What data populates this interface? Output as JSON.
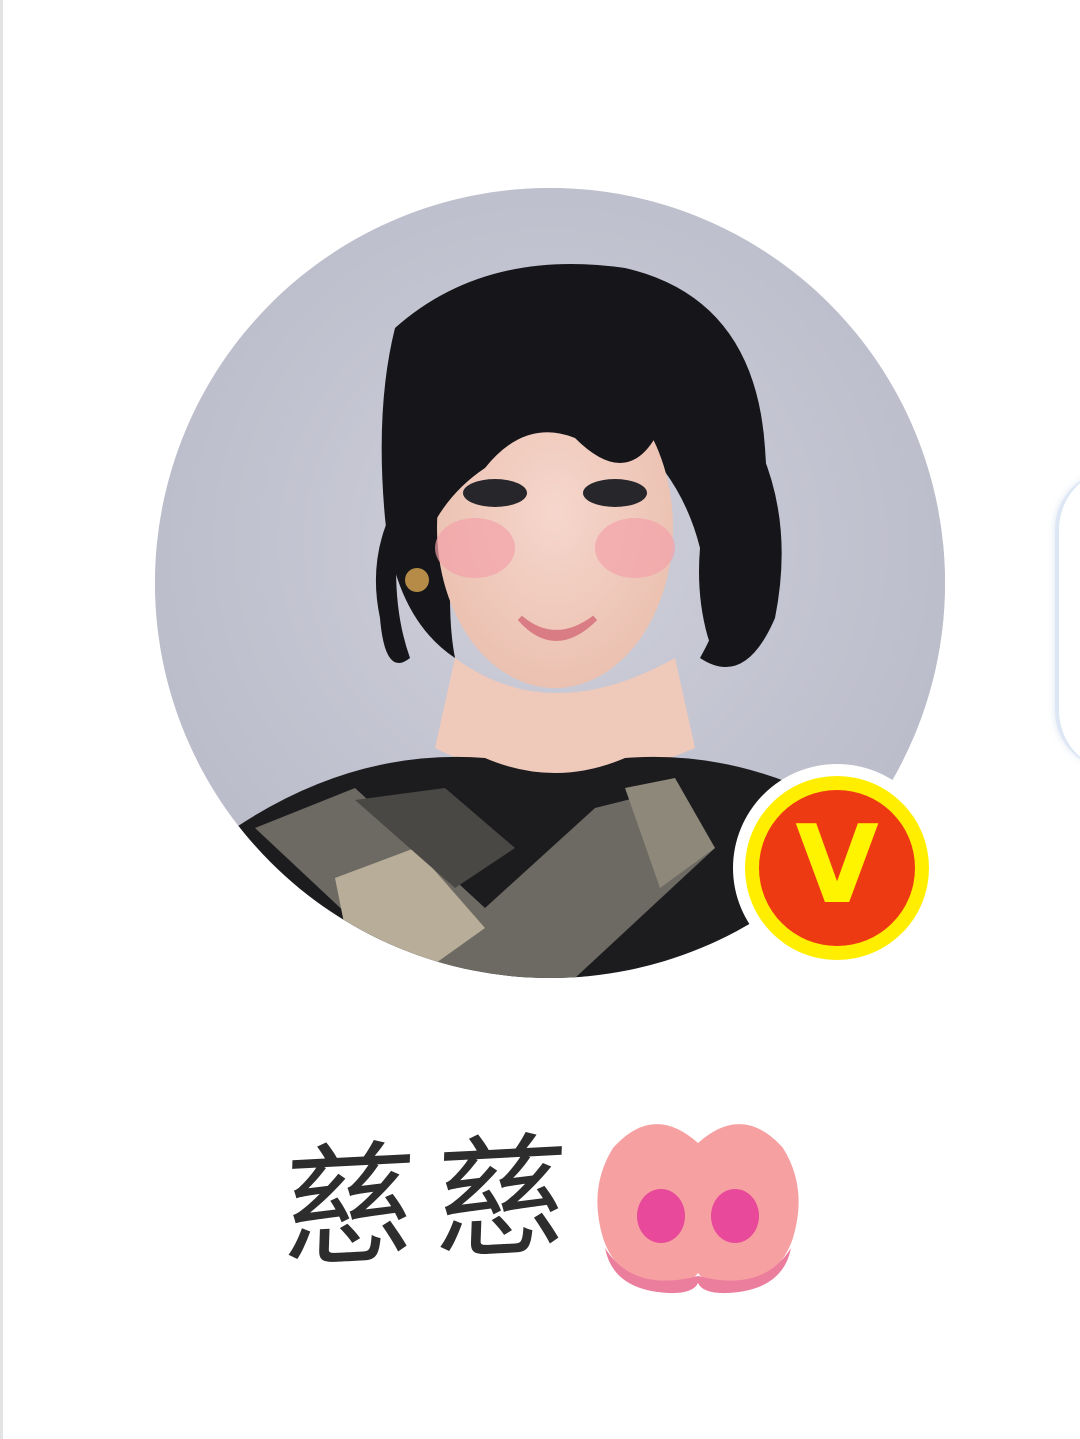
{
  "profile": {
    "nickname": "慈慈",
    "avatar_icon": "user-avatar-photo",
    "verified_icon": "verified-v-badge-icon",
    "verified_letter": "V",
    "name_badge_icon": "peach-icon"
  },
  "colors": {
    "verified_fill": "#ee3a12",
    "verified_ring": "#ffee00",
    "verified_letter": "#fff400",
    "peach": "#f7a0a2",
    "peach_dots": "#e8499a",
    "avatar_bg": "#c5c6d3"
  }
}
